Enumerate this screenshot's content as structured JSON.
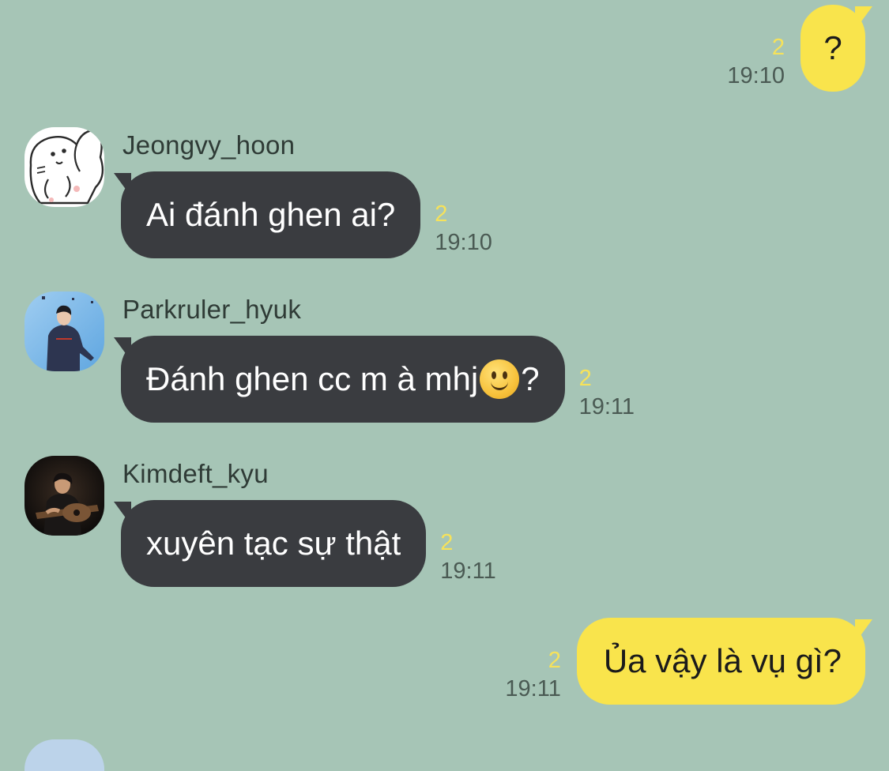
{
  "chat": {
    "messages": [
      {
        "direction": "outgoing",
        "text": "?",
        "unread": "2",
        "time": "19:10"
      },
      {
        "direction": "incoming",
        "sender": "Jeongvy_hoon",
        "avatar": "cartoon-bunny-avatar",
        "text": "Ai đánh ghen ai?",
        "unread": "2",
        "time": "19:10"
      },
      {
        "direction": "incoming",
        "sender": "Parkruler_hyuk",
        "avatar": "person-photo-avatar",
        "text_before_emoji": "Đánh ghen cc m à mhj",
        "emoji": "slightly-smiling-face-emoji",
        "text_after_emoji": "?",
        "unread": "2",
        "time": "19:11"
      },
      {
        "direction": "incoming",
        "sender": "Kimdeft_kyu",
        "avatar": "guitarist-photo-avatar",
        "text": "xuyên tạc sự thật",
        "unread": "2",
        "time": "19:11"
      },
      {
        "direction": "outgoing",
        "text": "Ủa vậy là vụ gì?",
        "unread": "2",
        "time": "19:11"
      }
    ]
  },
  "colors": {
    "background": "#a6c5b6",
    "outgoing_bubble": "#f9e44c",
    "incoming_bubble": "#3a3c40",
    "unread_count": "#f6e25a",
    "timestamp": "#4a5a53"
  }
}
